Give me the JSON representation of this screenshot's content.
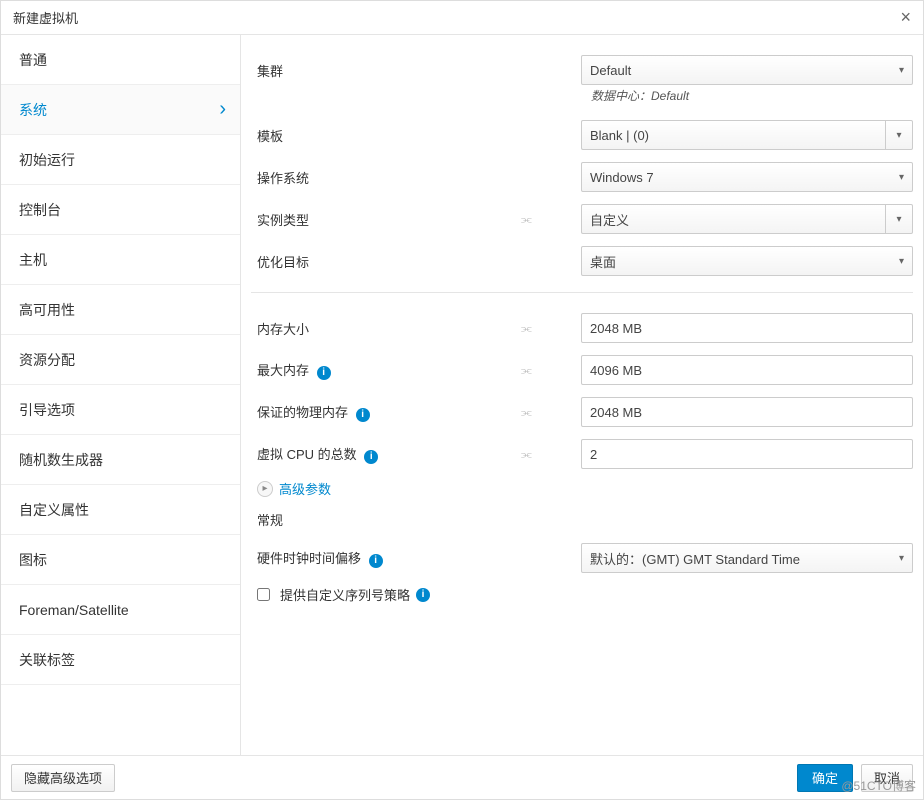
{
  "dialog": {
    "title": "新建虚拟机"
  },
  "sidebar": {
    "items": [
      {
        "label": "普通"
      },
      {
        "label": "系统"
      },
      {
        "label": "初始运行"
      },
      {
        "label": "控制台"
      },
      {
        "label": "主机"
      },
      {
        "label": "高可用性"
      },
      {
        "label": "资源分配"
      },
      {
        "label": "引导选项"
      },
      {
        "label": "随机数生成器"
      },
      {
        "label": "自定义属性"
      },
      {
        "label": "图标"
      },
      {
        "label": "Foreman/Satellite"
      },
      {
        "label": "关联标签"
      }
    ]
  },
  "form": {
    "cluster_label": "集群",
    "cluster_value": "Default",
    "datacenter_text": "数据中心：Default",
    "template_label": "模板",
    "template_value": "Blank |  (0)",
    "os_label": "操作系统",
    "os_value": "Windows 7",
    "instance_type_label": "实例类型",
    "instance_type_value": "自定义",
    "optimize_label": "优化目标",
    "optimize_value": "桌面",
    "memory_label": "内存大小",
    "memory_value": "2048 MB",
    "max_memory_label": "最大内存",
    "max_memory_value": "4096 MB",
    "guaranteed_label": "保证的物理内存",
    "guaranteed_value": "2048 MB",
    "vcpu_label": "虚拟 CPU 的总数",
    "vcpu_value": "2",
    "advanced_params": "高级参数",
    "general_heading": "常规",
    "clock_label": "硬件时钟时间偏移",
    "clock_value": "默认的：(GMT) GMT Standard Time",
    "custom_serial_label": "提供自定义序列号策略"
  },
  "footer": {
    "hide_adv": "隐藏高级选项",
    "ok": "确定",
    "cancel": "取消"
  },
  "watermark": "@51CTO博客"
}
